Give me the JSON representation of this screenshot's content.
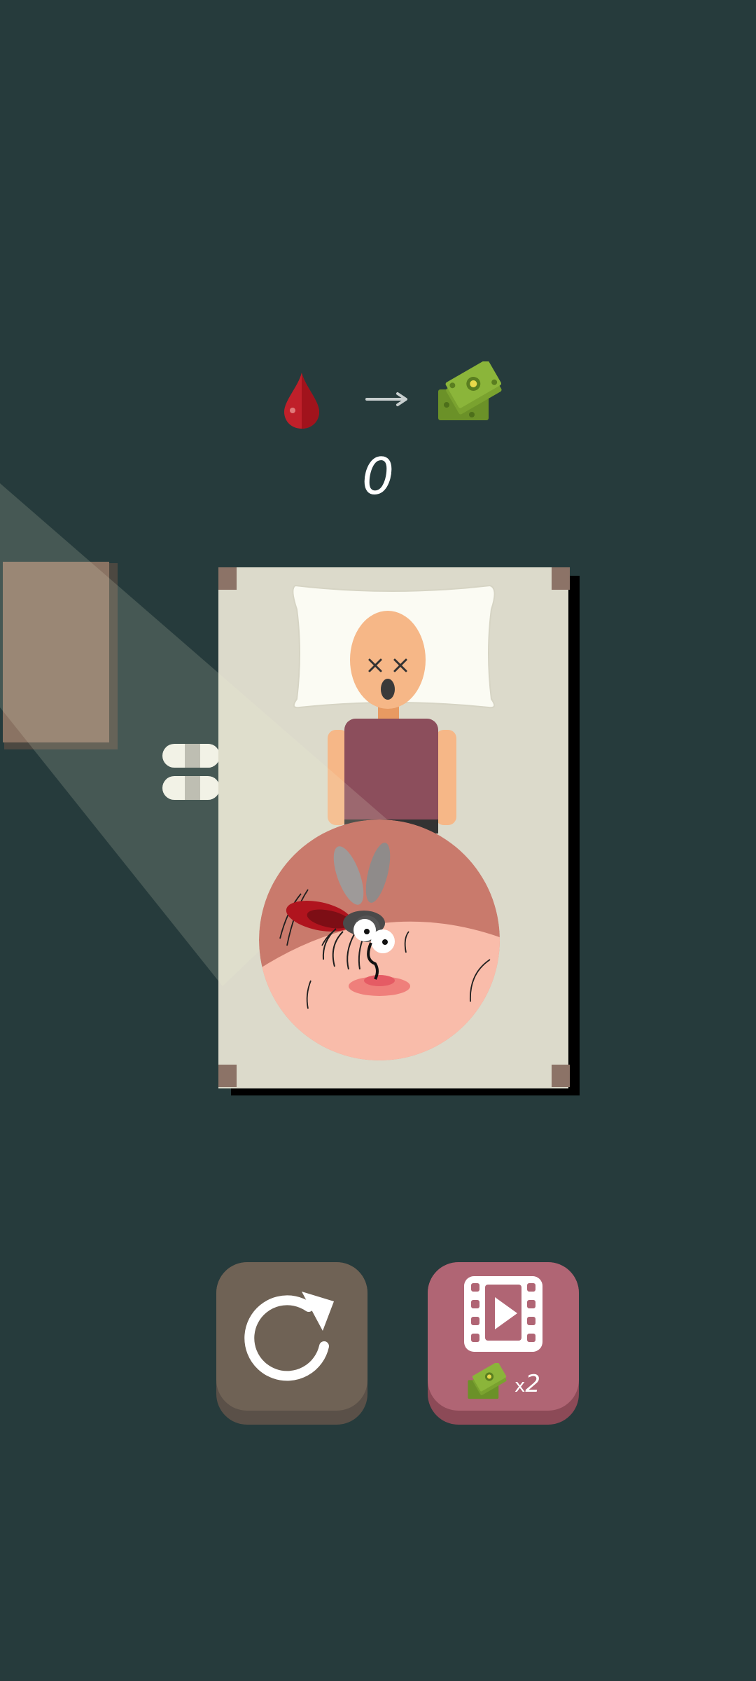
{
  "conversion": {
    "from_icon": "blood-drop-icon",
    "arrow_icon": "arrow-right-icon",
    "to_icon": "money-stack-icon"
  },
  "score": "0",
  "scene": {
    "sleeper_state": "knocked-out",
    "zoom_view": "mosquito-biting-skin"
  },
  "buttons": {
    "restart_icon": "restart-icon",
    "watch_ad_icon": "video-play-icon",
    "reward_icon": "money-stack-icon",
    "reward_multiplier_prefix": "x",
    "reward_multiplier_value": "2"
  },
  "colors": {
    "background": "#263b3c",
    "restart": "#6f6255",
    "watch_ad": "#b06574",
    "blood": "#c0202a",
    "money": "#8bb53a"
  }
}
